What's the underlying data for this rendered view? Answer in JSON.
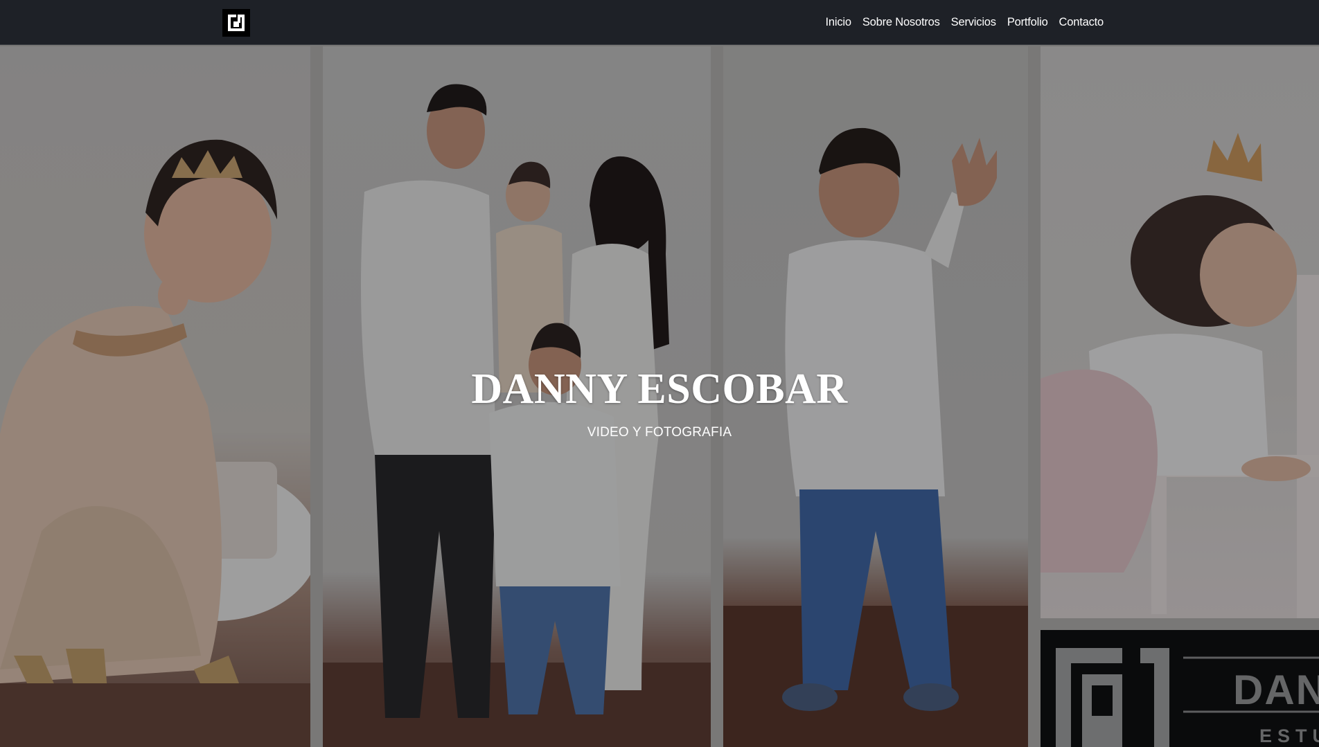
{
  "header": {
    "logo_icon": "brand-monogram-icon",
    "nav": [
      {
        "label": "Inicio"
      },
      {
        "label": "Sobre Nosotros"
      },
      {
        "label": "Servicios"
      },
      {
        "label": "Portfolio"
      },
      {
        "label": "Contacto"
      }
    ]
  },
  "hero": {
    "title": "DANNY ESCOBAR",
    "subtitle": "VIDEO Y FOTOGRAFIA",
    "photos": [
      {
        "subject": "baby girl in peach dress with tiara"
      },
      {
        "subject": "family portrait of four"
      },
      {
        "subject": "boy waving in white shirt and jeans"
      },
      {
        "subject": "baby girl with crown leaning on chair"
      },
      {
        "subject": "studio logo sign"
      }
    ],
    "logo_sign": {
      "name": "DAN",
      "sub": "ESTU"
    }
  },
  "colors": {
    "header_bg": "#1e2127",
    "overlay": "rgba(8,10,14,0.36)",
    "text": "#ffffff"
  }
}
